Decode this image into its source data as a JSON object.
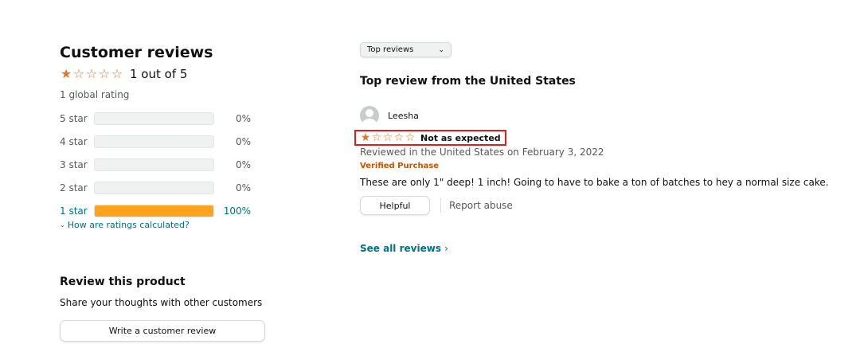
{
  "summary": {
    "title": "Customer reviews",
    "average_text": "1 out of 5",
    "average_rating": 1,
    "max_rating": 5,
    "global_ratings": "1 global rating",
    "histogram": [
      {
        "label": "5 star",
        "pct": "0%",
        "fraction": 0
      },
      {
        "label": "4 star",
        "pct": "0%",
        "fraction": 0
      },
      {
        "label": "3 star",
        "pct": "0%",
        "fraction": 0
      },
      {
        "label": "2 star",
        "pct": "0%",
        "fraction": 0
      },
      {
        "label": "1 star",
        "pct": "100%",
        "fraction": 1
      }
    ],
    "calc_link": "How are ratings calculated?"
  },
  "review_product": {
    "title": "Review this product",
    "subtitle": "Share your thoughts with other customers",
    "button": "Write a customer review"
  },
  "reviews": {
    "sort_selected": "Top reviews",
    "section_title": "Top review from the United States",
    "items": [
      {
        "author": "Leesha",
        "rating": 1,
        "headline": "Not as expected",
        "date_line": "Reviewed in the United States on February 3, 2022",
        "verified": "Verified Purchase",
        "body": "These are only 1\" deep! 1 inch! Going to have to bake a ton of batches to hey a normal size cake.",
        "helpful_label": "Helpful",
        "report_label": "Report abuse"
      }
    ],
    "see_all": "See all reviews",
    "see_all_chevron": "›"
  },
  "colors": {
    "star": "#DE7921",
    "bar_fill": "#FFA41C",
    "link": "#007185",
    "highlight_box": "#e21b1b",
    "verified": "#C45500"
  },
  "icons": {
    "filled_star": "★",
    "empty_star": "☆",
    "calc_chevron": "⌄",
    "select_chevron": "⌄"
  }
}
